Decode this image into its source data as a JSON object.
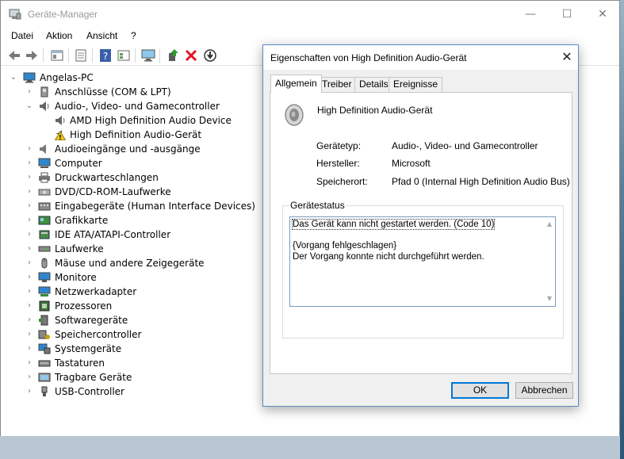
{
  "window": {
    "title": "Geräte-Manager",
    "controls": {
      "minimize": "—",
      "maximize": "☐",
      "close": "✕"
    }
  },
  "menu": [
    "Datei",
    "Aktion",
    "Ansicht",
    "?"
  ],
  "toolbar_icons": [
    "back-arrow-icon",
    "forward-arrow-icon",
    "computer-tree-icon",
    "properties-icon",
    "help-icon",
    "view-icon",
    "monitor-icon",
    "update-driver-icon",
    "uninstall-icon",
    "scan-hardware-icon"
  ],
  "tree": {
    "root": "Angelas-PC",
    "items": [
      "Anschlüsse (COM & LPT)",
      "Audio-, Video- und Gamecontroller",
      "AMD High Definition Audio Device",
      "High Definition Audio-Gerät",
      "Audioeingänge und -ausgänge",
      "Computer",
      "Druckwarteschlangen",
      "DVD/CD-ROM-Laufwerke",
      "Eingabegeräte (Human Interface Devices)",
      "Grafikkarte",
      "IDE ATA/ATAPI-Controller",
      "Laufwerke",
      "Mäuse und andere Zeigegeräte",
      "Monitore",
      "Netzwerkadapter",
      "Prozessoren",
      "Softwaregeräte",
      "Speichercontroller",
      "Systemgeräte",
      "Tastaturen",
      "Tragbare Geräte",
      "USB-Controller"
    ]
  },
  "dialog": {
    "title": "Eigenschaften von High Definition Audio-Gerät",
    "tabs": [
      "Allgemein",
      "Treiber",
      "Details",
      "Ereignisse"
    ],
    "active_tab": "Allgemein",
    "device_name": "High Definition Audio-Gerät",
    "properties": [
      {
        "label": "Gerätetyp:",
        "value": "Audio-, Video- und Gamecontroller"
      },
      {
        "label": "Hersteller:",
        "value": "Microsoft"
      },
      {
        "label": "Speicherort:",
        "value": "Pfad 0 (Internal High Definition Audio Bus)"
      }
    ],
    "status_group_label": "Gerätestatus",
    "status_line1": "Das Gerät kann nicht gestartet werden. (Code 10)",
    "status_line2": "{Vorgang fehlgeschlagen}",
    "status_line3": "Der Vorgang konnte nicht durchgeführt werden.",
    "ok_label": "OK",
    "cancel_label": "Abbrechen"
  },
  "colors": {
    "accent": "#0078d7",
    "warning": "#f2c511",
    "error_x": "#e81123"
  }
}
